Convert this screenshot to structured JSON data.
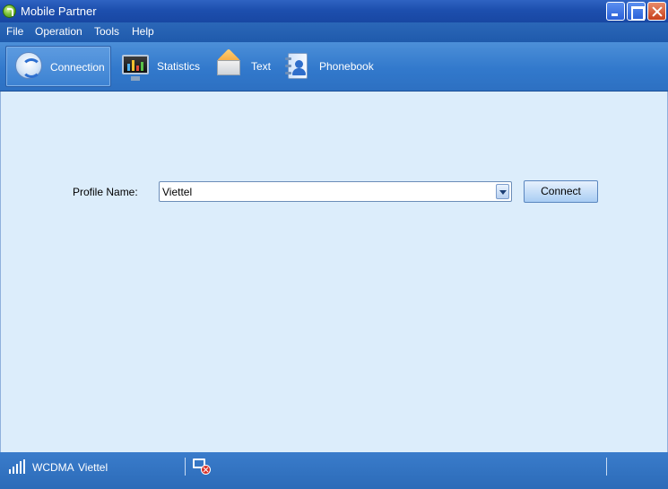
{
  "window": {
    "title": "Mobile Partner",
    "controls": {
      "minimize": "minimize",
      "maximize": "maximize",
      "close": "close"
    }
  },
  "menu": {
    "items": [
      "File",
      "Operation",
      "Tools",
      "Help"
    ]
  },
  "toolbar": {
    "items": [
      {
        "label": "Connection",
        "icon": "connection-icon",
        "active": true
      },
      {
        "label": "Statistics",
        "icon": "statistics-icon",
        "active": false
      },
      {
        "label": "Text",
        "icon": "envelope-icon",
        "active": false
      },
      {
        "label": "Phonebook",
        "icon": "phonebook-icon",
        "active": false
      }
    ]
  },
  "connection": {
    "profile_label": "Profile Name:",
    "profile_value": "Viettel",
    "connect_label": "Connect"
  },
  "status": {
    "network_type": "WCDMA",
    "operator": "Viettel",
    "connection_state_icon": "disconnected-icon"
  },
  "colors": {
    "titlebar": "#1d4fae",
    "toolbar": "#3279cc",
    "content_bg": "#dcedfb",
    "statusbar": "#2c6bb8"
  }
}
